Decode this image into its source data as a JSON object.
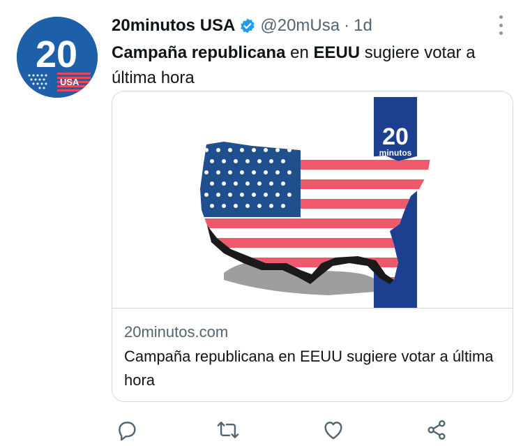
{
  "avatar": {
    "number": "20",
    "label": "USA",
    "icon": "20minutos-usa-logo"
  },
  "header": {
    "display_name": "20minutos USA",
    "verified_icon": "verified-badge-icon",
    "handle": "@20mUsa",
    "separator": "·",
    "time": "1d",
    "more_icon": "more-options-icon"
  },
  "tweet": {
    "text_bold_1": "Campaña republicana",
    "text_mid_1": " en ",
    "text_bold_2": "EEUU",
    "text_rest": " sugiere votar a última hora"
  },
  "card": {
    "image_logo_number": "20",
    "image_logo_text": "minutos",
    "domain": "20minutos.com",
    "title": "Campaña republicana en EEUU sugiere votar a última hora"
  },
  "actions": {
    "reply_icon": "reply-icon",
    "retweet_icon": "retweet-icon",
    "like_icon": "like-icon",
    "share_icon": "share-icon"
  },
  "colors": {
    "brand_blue": "#1d5fa8",
    "verified": "#1d9bf0",
    "text_secondary": "#536471",
    "flag_red": "#e8485a",
    "flag_blue": "#1f4f8c"
  }
}
